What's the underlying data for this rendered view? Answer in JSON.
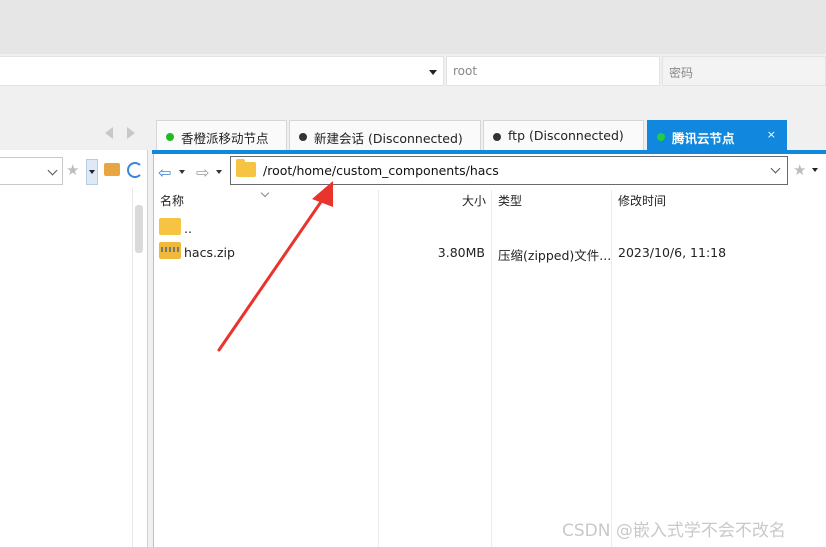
{
  "login": {
    "host_value": "",
    "user_placeholder": "root",
    "password_placeholder": "密码"
  },
  "tabs": [
    {
      "label": "香橙派移动节点",
      "status_color": "#22bb22",
      "active": false
    },
    {
      "label": "新建会话 (Disconnected)",
      "status_color": "#333333",
      "active": false
    },
    {
      "label": "ftp (Disconnected)",
      "status_color": "#333333",
      "active": false
    },
    {
      "label": "腾讯云节点",
      "status_color": "#22cc44",
      "active": true,
      "close": "×"
    }
  ],
  "remote": {
    "path": "/root/home/custom_components/hacs",
    "columns": {
      "name": "名称",
      "size": "大小",
      "type": "类型",
      "mtime": "修改时间"
    },
    "rows": [
      {
        "icon": "folder-icon",
        "name": "..",
        "size": "",
        "type": "",
        "mtime": ""
      },
      {
        "icon": "zip-file-icon",
        "name": "hacs.zip",
        "size": "3.80MB",
        "type": "压缩(zipped)文件...",
        "mtime": "2023/10/6, 11:18"
      }
    ]
  },
  "colors": {
    "accent": "#1188dd",
    "annotation_arrow": "#e8342c"
  },
  "watermark": "CSDN @嵌入式学不会不改名"
}
